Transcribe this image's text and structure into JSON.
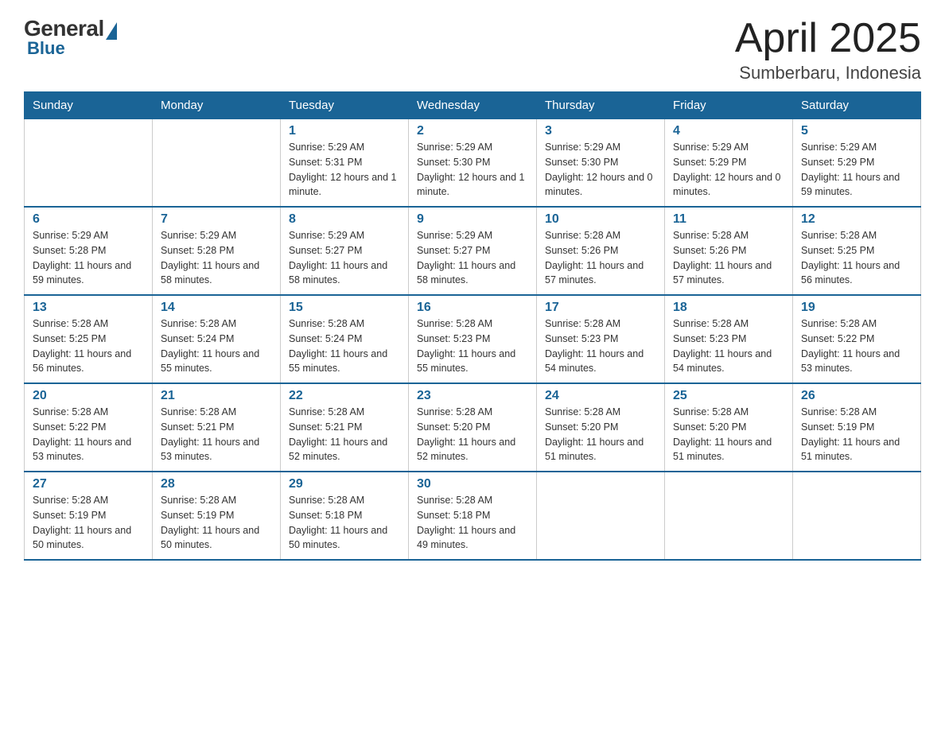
{
  "logo": {
    "general": "General",
    "blue": "Blue"
  },
  "title": {
    "month_year": "April 2025",
    "location": "Sumberbaru, Indonesia"
  },
  "headers": [
    "Sunday",
    "Monday",
    "Tuesday",
    "Wednesday",
    "Thursday",
    "Friday",
    "Saturday"
  ],
  "weeks": [
    [
      {
        "day": "",
        "info": ""
      },
      {
        "day": "",
        "info": ""
      },
      {
        "day": "1",
        "info": "Sunrise: 5:29 AM\nSunset: 5:31 PM\nDaylight: 12 hours and 1 minute."
      },
      {
        "day": "2",
        "info": "Sunrise: 5:29 AM\nSunset: 5:30 PM\nDaylight: 12 hours and 1 minute."
      },
      {
        "day": "3",
        "info": "Sunrise: 5:29 AM\nSunset: 5:30 PM\nDaylight: 12 hours and 0 minutes."
      },
      {
        "day": "4",
        "info": "Sunrise: 5:29 AM\nSunset: 5:29 PM\nDaylight: 12 hours and 0 minutes."
      },
      {
        "day": "5",
        "info": "Sunrise: 5:29 AM\nSunset: 5:29 PM\nDaylight: 11 hours and 59 minutes."
      }
    ],
    [
      {
        "day": "6",
        "info": "Sunrise: 5:29 AM\nSunset: 5:28 PM\nDaylight: 11 hours and 59 minutes."
      },
      {
        "day": "7",
        "info": "Sunrise: 5:29 AM\nSunset: 5:28 PM\nDaylight: 11 hours and 58 minutes."
      },
      {
        "day": "8",
        "info": "Sunrise: 5:29 AM\nSunset: 5:27 PM\nDaylight: 11 hours and 58 minutes."
      },
      {
        "day": "9",
        "info": "Sunrise: 5:29 AM\nSunset: 5:27 PM\nDaylight: 11 hours and 58 minutes."
      },
      {
        "day": "10",
        "info": "Sunrise: 5:28 AM\nSunset: 5:26 PM\nDaylight: 11 hours and 57 minutes."
      },
      {
        "day": "11",
        "info": "Sunrise: 5:28 AM\nSunset: 5:26 PM\nDaylight: 11 hours and 57 minutes."
      },
      {
        "day": "12",
        "info": "Sunrise: 5:28 AM\nSunset: 5:25 PM\nDaylight: 11 hours and 56 minutes."
      }
    ],
    [
      {
        "day": "13",
        "info": "Sunrise: 5:28 AM\nSunset: 5:25 PM\nDaylight: 11 hours and 56 minutes."
      },
      {
        "day": "14",
        "info": "Sunrise: 5:28 AM\nSunset: 5:24 PM\nDaylight: 11 hours and 55 minutes."
      },
      {
        "day": "15",
        "info": "Sunrise: 5:28 AM\nSunset: 5:24 PM\nDaylight: 11 hours and 55 minutes."
      },
      {
        "day": "16",
        "info": "Sunrise: 5:28 AM\nSunset: 5:23 PM\nDaylight: 11 hours and 55 minutes."
      },
      {
        "day": "17",
        "info": "Sunrise: 5:28 AM\nSunset: 5:23 PM\nDaylight: 11 hours and 54 minutes."
      },
      {
        "day": "18",
        "info": "Sunrise: 5:28 AM\nSunset: 5:23 PM\nDaylight: 11 hours and 54 minutes."
      },
      {
        "day": "19",
        "info": "Sunrise: 5:28 AM\nSunset: 5:22 PM\nDaylight: 11 hours and 53 minutes."
      }
    ],
    [
      {
        "day": "20",
        "info": "Sunrise: 5:28 AM\nSunset: 5:22 PM\nDaylight: 11 hours and 53 minutes."
      },
      {
        "day": "21",
        "info": "Sunrise: 5:28 AM\nSunset: 5:21 PM\nDaylight: 11 hours and 53 minutes."
      },
      {
        "day": "22",
        "info": "Sunrise: 5:28 AM\nSunset: 5:21 PM\nDaylight: 11 hours and 52 minutes."
      },
      {
        "day": "23",
        "info": "Sunrise: 5:28 AM\nSunset: 5:20 PM\nDaylight: 11 hours and 52 minutes."
      },
      {
        "day": "24",
        "info": "Sunrise: 5:28 AM\nSunset: 5:20 PM\nDaylight: 11 hours and 51 minutes."
      },
      {
        "day": "25",
        "info": "Sunrise: 5:28 AM\nSunset: 5:20 PM\nDaylight: 11 hours and 51 minutes."
      },
      {
        "day": "26",
        "info": "Sunrise: 5:28 AM\nSunset: 5:19 PM\nDaylight: 11 hours and 51 minutes."
      }
    ],
    [
      {
        "day": "27",
        "info": "Sunrise: 5:28 AM\nSunset: 5:19 PM\nDaylight: 11 hours and 50 minutes."
      },
      {
        "day": "28",
        "info": "Sunrise: 5:28 AM\nSunset: 5:19 PM\nDaylight: 11 hours and 50 minutes."
      },
      {
        "day": "29",
        "info": "Sunrise: 5:28 AM\nSunset: 5:18 PM\nDaylight: 11 hours and 50 minutes."
      },
      {
        "day": "30",
        "info": "Sunrise: 5:28 AM\nSunset: 5:18 PM\nDaylight: 11 hours and 49 minutes."
      },
      {
        "day": "",
        "info": ""
      },
      {
        "day": "",
        "info": ""
      },
      {
        "day": "",
        "info": ""
      }
    ]
  ]
}
